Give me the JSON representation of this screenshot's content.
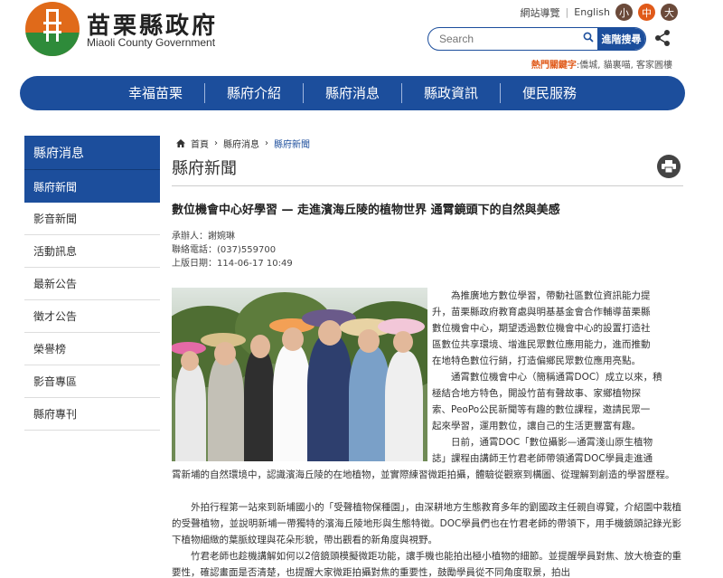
{
  "header": {
    "brand_zh": "苗栗縣政府",
    "brand_en": "Miaoli County Government",
    "sitemap": "網站導覽",
    "english": "English",
    "font_sizes": [
      "小",
      "中",
      "大"
    ],
    "search_placeholder": "Search",
    "advanced_search": "進階搜尋",
    "hot_keys_label": "熱門關鍵字",
    "hot_keys": ":僑城, 貓裏喵, 客家圓樓"
  },
  "nav": [
    "幸福苗栗",
    "縣府介紹",
    "縣府消息",
    "縣政資訊",
    "便民服務"
  ],
  "sidebar": {
    "title": "縣府消息",
    "items": [
      "縣府新聞",
      "影音新聞",
      "活動訊息",
      "最新公告",
      "徵才公告",
      "榮譽榜",
      "影音專區",
      "縣府專刊"
    ]
  },
  "breadcrumb": [
    "首頁",
    "縣府消息",
    "縣府新聞"
  ],
  "page_title": "縣府新聞",
  "article": {
    "title": "數位機會中心好學習 — 走進濱海丘陵的植物世界 通霄鏡頭下的自然與美感",
    "organizer": "承辦人：謝婉琳",
    "phone": "聯絡電話：(037)559700",
    "date": "上版日期：114-06-17 10:49",
    "p1_lines": [
      "　　為推廣地方數位學習，帶動社區數位資訊能力提",
      "升，苗栗縣政府教育處與明基基金會合作輔導苗栗縣",
      "數位機會中心，期望透過數位機會中心的設置打造社",
      "區數位共享環境、增進民眾數位應用能力，進而推動",
      "在地特色數位行銷，打造偏鄉民眾數位應用亮點。",
      "　　通霄數位機會中心（簡稱通霄DOC）成立以來，積",
      "極結合地方特色，開設竹苗有聲故事、家鄉植物探",
      "索、PeoPo公民新聞等有趣的數位課程，邀請民眾一",
      "起來學習，運用數位，讓自己的生活更豐富有趣。",
      "　　日前，通霄DOC「數位攝影—通霄淺山原生植物",
      "誌」課程由講師王竹君老師帶領通霄DOC學員走進通"
    ],
    "p1_tail": "霄新埔的自然環境中，認識濱海丘陵的在地植物，並實際練習微距拍攝，體驗從觀察到構圖、從理解到創造的學習歷程。",
    "p2": "　　外拍行程第一站來到新埔國小的「受聲植物保種園」，由深耕地方生態教育多年的劉國政主任親自導覽，介紹園中栽植的受聲植物，並說明新埔一帶獨特的濱海丘陵地形與生態特徵。DOC學員們也在竹君老師的帶領下，用手機鏡頭記錄光影下植物細緻的葉脈紋理與花朵形貌，帶出觀看的新角度與視野。",
    "p3": "　　竹君老師也趁機講解如何以2倍鏡頭模擬微距功能，讓手機也能拍出極小植物的細節。並提醒學員對焦、放大檢查的重要性，確認畫面是否清楚，也提醒大家微距拍攝對焦的重要性，鼓勵學員從不同角度取景，拍出"
  },
  "colors": {
    "primary": "#1c4e9c",
    "accent": "#e05a1a"
  }
}
